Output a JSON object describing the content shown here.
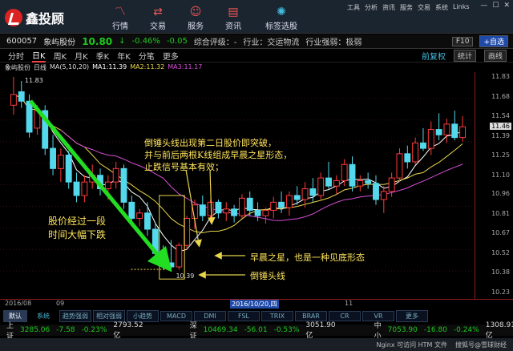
{
  "app": {
    "name": "鑫投顾"
  },
  "nav": [
    {
      "label": "行情",
      "icon": "chart-line-icon"
    },
    {
      "label": "交易",
      "icon": "trade-icon"
    },
    {
      "label": "服务",
      "icon": "user-icon"
    },
    {
      "label": "资讯",
      "icon": "news-icon"
    },
    {
      "label": "标签选股",
      "icon": "bulb-icon"
    }
  ],
  "window_links": [
    "工具",
    "分析",
    "资讯",
    "服务",
    "交易",
    "系统",
    "Links"
  ],
  "stock": {
    "code": "600057",
    "name": "象屿股份",
    "price": "10.80",
    "arrow": "↓",
    "change_pct": "-0.46%",
    "change": "-0.05",
    "rating": "综合评级：-",
    "industry": "行业：交运物流",
    "strength": "行业强弱：极弱",
    "f10": "F10",
    "add": "+自选"
  },
  "periods": [
    "分时",
    "日K",
    "周K",
    "月K",
    "季K",
    "年K",
    "分笔",
    "更多"
  ],
  "period_active": "日K",
  "chart_controls": [
    "前复权",
    "统计",
    "画线"
  ],
  "ma_legend": {
    "name": "象屿股份",
    "sub": "日线",
    "ma": "MA(5,10,20)",
    "ma1": "MA1:11.39",
    "ma2": "MA2:11.32",
    "ma3": "MA3:11.17"
  },
  "price_axis": [
    "11.83",
    "11.68",
    "11.54",
    "11.39",
    "11.25",
    "11.10",
    "10.96",
    "10.81",
    "10.67",
    "10.52",
    "10.38",
    "10.23"
  ],
  "last_price": "11.46",
  "high_label": "11.83",
  "low_label": "10.39",
  "date_axis": {
    "start": "2016/08",
    "m1": "09",
    "highlight": "2016/10/20,四",
    "m2": "11"
  },
  "annotations": {
    "top1": "倒锤头线出现第二日股价即突破，",
    "top2": "并与前后两根K线组成早晨之星形态，",
    "top3": "止跌信号基本有效；",
    "left1": "股价经过一段",
    "left2": "时间大幅下跌",
    "star": "早晨之星，也是一种见底形态",
    "hammer": "倒锤头线"
  },
  "indicators": [
    "默认",
    "系统",
    "趋势强弱",
    "相对强弱",
    "小趋势",
    "MACD",
    "DMI",
    "FSL",
    "TRIX",
    "BRAR",
    "CR",
    "VR",
    "更多"
  ],
  "ticker": [
    {
      "name": "上证",
      "value": "3285.06",
      "chg": "-7.58",
      "pct": "-0.23%",
      "amount": "2793.52亿"
    },
    {
      "name": "深证",
      "value": "10469.34",
      "chg": "-56.01",
      "pct": "-0.53%",
      "amount": "3051.90亿"
    },
    {
      "name": "中小",
      "value": "7053.90",
      "chg": "-16.80",
      "pct": "-0.24%",
      "amount": "1308.91亿"
    }
  ],
  "status": [
    "Nginx 可访问 HTM 文件",
    "搜狐号@雪球财经"
  ],
  "chart_data": {
    "type": "candlestick",
    "note": "Daily K-line; values in yuan, read approximately from price axis",
    "candles": [
      {
        "o": 11.62,
        "h": 11.83,
        "l": 11.55,
        "c": 11.7
      },
      {
        "o": 11.72,
        "h": 11.8,
        "l": 11.6,
        "c": 11.65
      },
      {
        "o": 11.65,
        "h": 11.7,
        "l": 11.38,
        "c": 11.42
      },
      {
        "o": 11.45,
        "h": 11.62,
        "l": 11.4,
        "c": 11.58
      },
      {
        "o": 11.58,
        "h": 11.62,
        "l": 11.25,
        "c": 11.3
      },
      {
        "o": 11.3,
        "h": 11.4,
        "l": 11.1,
        "c": 11.15
      },
      {
        "o": 11.15,
        "h": 11.3,
        "l": 11.05,
        "c": 11.25
      },
      {
        "o": 11.25,
        "h": 11.28,
        "l": 11.0,
        "c": 11.05
      },
      {
        "o": 11.05,
        "h": 11.12,
        "l": 10.9,
        "c": 10.95
      },
      {
        "o": 10.95,
        "h": 11.1,
        "l": 10.9,
        "c": 11.05
      },
      {
        "o": 11.05,
        "h": 11.18,
        "l": 11.0,
        "c": 11.1
      },
      {
        "o": 11.1,
        "h": 11.15,
        "l": 10.95,
        "c": 11.0
      },
      {
        "o": 11.0,
        "h": 11.1,
        "l": 10.92,
        "c": 11.05
      },
      {
        "o": 11.05,
        "h": 11.2,
        "l": 11.0,
        "c": 11.15
      },
      {
        "o": 11.15,
        "h": 11.18,
        "l": 10.85,
        "c": 10.9
      },
      {
        "o": 10.9,
        "h": 10.95,
        "l": 10.72,
        "c": 10.78
      },
      {
        "o": 10.78,
        "h": 10.85,
        "l": 10.72,
        "c": 10.82
      },
      {
        "o": 10.82,
        "h": 10.9,
        "l": 10.65,
        "c": 10.7
      },
      {
        "o": 10.7,
        "h": 10.75,
        "l": 10.48,
        "c": 10.52
      },
      {
        "o": 10.52,
        "h": 10.58,
        "l": 10.4,
        "c": 10.45
      },
      {
        "o": 10.45,
        "h": 10.62,
        "l": 10.39,
        "c": 10.42
      },
      {
        "o": 10.42,
        "h": 10.6,
        "l": 10.4,
        "c": 10.58
      },
      {
        "o": 10.58,
        "h": 10.8,
        "l": 10.55,
        "c": 10.78
      },
      {
        "o": 10.78,
        "h": 10.92,
        "l": 10.7,
        "c": 10.88
      },
      {
        "o": 10.88,
        "h": 10.95,
        "l": 10.76,
        "c": 10.8
      },
      {
        "o": 10.8,
        "h": 10.92,
        "l": 10.75,
        "c": 10.9
      },
      {
        "o": 10.9,
        "h": 10.92,
        "l": 10.78,
        "c": 10.82
      },
      {
        "o": 10.82,
        "h": 10.9,
        "l": 10.76,
        "c": 10.85
      },
      {
        "o": 10.85,
        "h": 10.88,
        "l": 10.75,
        "c": 10.8
      },
      {
        "o": 10.8,
        "h": 10.96,
        "l": 10.78,
        "c": 10.93
      },
      {
        "o": 10.93,
        "h": 10.98,
        "l": 10.8,
        "c": 10.84
      },
      {
        "o": 10.84,
        "h": 10.9,
        "l": 10.76,
        "c": 10.8
      },
      {
        "o": 10.8,
        "h": 10.86,
        "l": 10.74,
        "c": 10.84
      },
      {
        "o": 10.84,
        "h": 10.94,
        "l": 10.78,
        "c": 10.9
      },
      {
        "o": 10.9,
        "h": 10.98,
        "l": 10.82,
        "c": 10.86
      },
      {
        "o": 10.86,
        "h": 10.98,
        "l": 10.8,
        "c": 10.95
      },
      {
        "o": 10.95,
        "h": 11.02,
        "l": 10.88,
        "c": 10.92
      },
      {
        "o": 10.92,
        "h": 11.05,
        "l": 10.86,
        "c": 11.0
      },
      {
        "o": 11.0,
        "h": 11.08,
        "l": 10.9,
        "c": 10.95
      },
      {
        "o": 10.95,
        "h": 11.12,
        "l": 10.92,
        "c": 11.08
      },
      {
        "o": 11.08,
        "h": 11.2,
        "l": 11.0,
        "c": 11.02
      },
      {
        "o": 11.02,
        "h": 11.1,
        "l": 10.96,
        "c": 11.06
      },
      {
        "o": 11.06,
        "h": 11.22,
        "l": 11.02,
        "c": 11.18
      },
      {
        "o": 11.18,
        "h": 11.24,
        "l": 10.98,
        "c": 11.02
      },
      {
        "o": 11.02,
        "h": 11.1,
        "l": 10.98,
        "c": 11.06
      },
      {
        "o": 11.06,
        "h": 11.12,
        "l": 11.0,
        "c": 11.04
      },
      {
        "o": 11.04,
        "h": 11.1,
        "l": 10.88,
        "c": 10.92
      },
      {
        "o": 10.92,
        "h": 11.02,
        "l": 10.82,
        "c": 10.98
      },
      {
        "o": 10.98,
        "h": 11.12,
        "l": 10.94,
        "c": 11.08
      },
      {
        "o": 11.08,
        "h": 11.3,
        "l": 11.05,
        "c": 11.26
      },
      {
        "o": 11.26,
        "h": 11.32,
        "l": 11.15,
        "c": 11.2
      },
      {
        "o": 11.2,
        "h": 11.38,
        "l": 11.18,
        "c": 11.34
      },
      {
        "o": 11.34,
        "h": 11.45,
        "l": 11.28,
        "c": 11.3
      },
      {
        "o": 11.3,
        "h": 11.5,
        "l": 11.25,
        "c": 11.44
      },
      {
        "o": 11.44,
        "h": 11.56,
        "l": 11.36,
        "c": 11.4
      },
      {
        "o": 11.4,
        "h": 11.52,
        "l": 11.34,
        "c": 11.48
      },
      {
        "o": 11.48,
        "h": 11.58,
        "l": 11.36,
        "c": 11.38
      },
      {
        "o": 11.38,
        "h": 11.54,
        "l": 11.35,
        "c": 11.46
      }
    ],
    "ylim": [
      10.23,
      11.83
    ]
  }
}
